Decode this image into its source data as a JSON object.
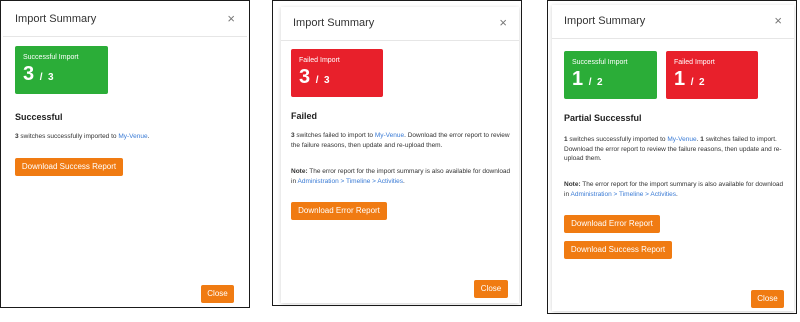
{
  "panels": {
    "success": {
      "title": "Import Summary",
      "close_symbol": "×",
      "card": {
        "label": "Successful Import",
        "count": "3",
        "separator": "/",
        "total": "3",
        "color": "#2bad38"
      },
      "status": "Successful",
      "message": {
        "count": "3",
        "text": " switches successfully imported to ",
        "venue": "My-Venue",
        "end": "."
      },
      "download_button": "Download Success Report",
      "close_button": "Close"
    },
    "failed": {
      "title": "Import Summary",
      "close_symbol": "×",
      "card": {
        "label": "Failed Import",
        "count": "3",
        "separator": "/",
        "total": "3",
        "color": "#e8202b"
      },
      "status": "Failed",
      "message": {
        "count": "3",
        "text": " switches failed to import to ",
        "venue": "My-Venue",
        "rest": ". Download the error report to review the failure reasons, then update and re-upload them."
      },
      "note": {
        "label": "Note:",
        "text": " The error report for the import summary is also available for download in ",
        "path": "Administration > Timeline > Activities",
        "end": "."
      },
      "download_button": "Download Error Report",
      "close_button": "Close"
    },
    "partial": {
      "title": "Import Summary",
      "close_symbol": "×",
      "success_card": {
        "label": "Successful Import",
        "count": "1",
        "separator": "/",
        "total": "2",
        "color": "#2bad38"
      },
      "failed_card": {
        "label": "Failed Import",
        "count": "1",
        "separator": "/",
        "total": "2",
        "color": "#e8202b"
      },
      "status": "Partial Successful",
      "message": {
        "success_count": "1",
        "text1": " switches successfully imported to ",
        "venue": "My-Venue",
        "sep": ". ",
        "failed_count": "1",
        "text2": " switches failed to import. Download the error report to review the failure reasons, then update and re-upload them."
      },
      "note": {
        "label": "Note:",
        "text": " The error report for the import summary is also available for download in ",
        "path": "Administration > Timeline > Activities",
        "end": "."
      },
      "error_button": "Download Error Report",
      "success_button": "Download Success Report",
      "close_button": "Close"
    }
  },
  "colors": {
    "accent": "#f07b12",
    "link": "#3a7bd5"
  }
}
